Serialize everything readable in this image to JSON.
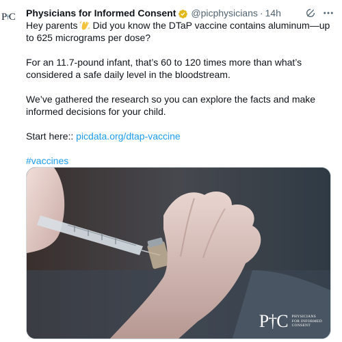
{
  "post": {
    "display_name": "Physicians for Informed Consent",
    "handle": "@picphysicians",
    "separator": "·",
    "time": "14h",
    "paragraphs": {
      "p1_before": "Hey parents",
      "p1_after": "Did you know the DTaP vaccine contains aluminum—up to 625 micrograms per dose?",
      "p2": "For an 11.7-pound infant, that’s 60 to 120 times more than what’s considered a safe daily level in the bloodstream.",
      "p3": "We’ve gathered the research so you can explore the facts and make informed decisions for your child.",
      "p4_label": "Start here::",
      "p4_link": "picdata.org/dtap-vaccine",
      "hashtag": "#vaccines"
    },
    "emoji": "waving-hand-icon",
    "verified_badge_color": "#e2b719",
    "link_color": "#1d9bf0"
  },
  "media": {
    "description_icon": "vaccine-syringe-photo",
    "logo_letters": "P†C",
    "logo_subtitle_line1": "Physicians",
    "logo_subtitle_line2": "for Informed",
    "logo_subtitle_line3": "Consent"
  },
  "icons": {
    "grok": "grok-icon",
    "more": "more-icon"
  }
}
